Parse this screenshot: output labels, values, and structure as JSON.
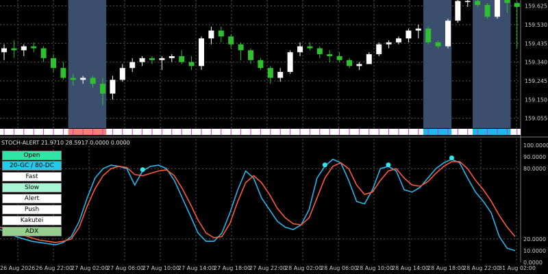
{
  "indicator": {
    "title": "STOCH-ALERT 21.9710 28.5917 0.0000 0.0000"
  },
  "buttons": {
    "open": "Open",
    "gcdc": "20-GC / 80-DC",
    "fast": "Fast",
    "slow": "Slow",
    "alert": "Alert",
    "push": "Push",
    "kakutei": "Kakutei",
    "adx": "ADX"
  },
  "price_axis": [
    "159.625",
    "159.530",
    "159.435",
    "159.340",
    "159.245",
    "159.150",
    "159.055"
  ],
  "stoch_axis": [
    "100.0000",
    "90.0000",
    "80.0000",
    "20.0000",
    "10.0000",
    "0.0000"
  ],
  "time_axis": [
    "26 Aug 2026",
    "26 Aug 22:00",
    "27 Aug 02:00",
    "27 Aug 06:00",
    "27 Aug 10:00",
    "27 Aug 14:00",
    "27 Aug 18:00",
    "27 Aug 22:00",
    "28 Aug 02:00",
    "28 Aug 06:00",
    "28 Aug 10:00",
    "28 Aug 14:00",
    "28 Aug 18:00",
    "28 Aug 22:00",
    "31 Aug 02:00"
  ],
  "colors": {
    "bull": "#ffffff",
    "bear": "#2fbf2f",
    "highlight": "#3c4e6e",
    "fast_line": "#26b7ec",
    "slow_line": "#ff5a3c",
    "marker": "#2fe6f0",
    "magenta_tick": "#cc33cc"
  },
  "chart_data": {
    "type": "candlestick",
    "price_ylim": [
      159.005,
      159.655
    ],
    "candles": [
      [
        159.39,
        159.43,
        159.35,
        159.41
      ],
      [
        159.41,
        159.45,
        159.36,
        159.4
      ],
      [
        159.4,
        159.43,
        159.37,
        159.42
      ],
      [
        159.42,
        159.44,
        159.39,
        159.41
      ],
      [
        159.41,
        159.42,
        159.34,
        159.36
      ],
      [
        159.36,
        159.38,
        159.29,
        159.31
      ],
      [
        159.31,
        159.34,
        159.25,
        159.26
      ],
      [
        159.26,
        159.28,
        159.22,
        159.25
      ],
      [
        159.25,
        159.27,
        159.23,
        159.26
      ],
      [
        159.26,
        159.27,
        159.21,
        159.23
      ],
      [
        159.23,
        159.26,
        159.12,
        159.18
      ],
      [
        159.18,
        159.27,
        159.15,
        159.25
      ],
      [
        159.25,
        159.33,
        159.24,
        159.31
      ],
      [
        159.31,
        159.36,
        159.29,
        159.34
      ],
      [
        159.34,
        159.37,
        159.32,
        159.36
      ],
      [
        159.36,
        159.37,
        159.33,
        159.35
      ],
      [
        159.35,
        159.37,
        159.3,
        159.36
      ],
      [
        159.36,
        159.38,
        159.34,
        159.37
      ],
      [
        159.37,
        159.4,
        159.33,
        159.34
      ],
      [
        159.34,
        159.37,
        159.3,
        159.32
      ],
      [
        159.32,
        159.47,
        159.3,
        159.46
      ],
      [
        159.46,
        159.52,
        159.43,
        159.5
      ],
      [
        159.5,
        159.52,
        159.44,
        159.47
      ],
      [
        159.47,
        159.48,
        159.41,
        159.43
      ],
      [
        159.43,
        159.44,
        159.35,
        159.4
      ],
      [
        159.4,
        159.41,
        159.33,
        159.35
      ],
      [
        159.35,
        159.36,
        159.3,
        159.31
      ],
      [
        159.31,
        159.32,
        159.23,
        159.26
      ],
      [
        159.26,
        159.31,
        159.24,
        159.29
      ],
      [
        159.29,
        159.4,
        159.28,
        159.39
      ],
      [
        159.39,
        159.44,
        159.37,
        159.42
      ],
      [
        159.42,
        159.44,
        159.4,
        159.41
      ],
      [
        159.41,
        159.42,
        159.36,
        159.38
      ],
      [
        159.38,
        159.4,
        159.34,
        159.37
      ],
      [
        159.37,
        159.39,
        159.34,
        159.35
      ],
      [
        159.35,
        159.36,
        159.31,
        159.32
      ],
      [
        159.32,
        159.34,
        159.3,
        159.33
      ],
      [
        159.33,
        159.39,
        159.33,
        159.38
      ],
      [
        159.38,
        159.44,
        159.37,
        159.43
      ],
      [
        159.43,
        159.45,
        159.41,
        159.44
      ],
      [
        159.44,
        159.47,
        159.43,
        159.46
      ],
      [
        159.46,
        159.51,
        159.44,
        159.5
      ],
      [
        159.5,
        159.53,
        159.46,
        159.51
      ],
      [
        159.51,
        159.52,
        159.43,
        159.44
      ],
      [
        159.44,
        159.45,
        159.41,
        159.42
      ],
      [
        159.42,
        159.56,
        159.41,
        159.55
      ],
      [
        159.55,
        159.66,
        159.54,
        159.65
      ],
      [
        159.65,
        159.67,
        159.62,
        159.65
      ],
      [
        159.65,
        159.66,
        159.62,
        159.63
      ],
      [
        159.63,
        159.64,
        159.56,
        159.57
      ],
      [
        159.57,
        159.66,
        159.56,
        159.66
      ],
      [
        159.66,
        159.67,
        159.59,
        159.64
      ],
      [
        159.64,
        159.65,
        159.41,
        159.62
      ]
    ],
    "highlight_candle_ranges": [
      [
        7,
        10
      ],
      [
        43,
        45
      ],
      [
        48,
        51
      ],
      [
        59,
        60
      ]
    ],
    "stoch_ylim": [
      0,
      100
    ],
    "series": [
      {
        "name": "Fast",
        "values": [
          28,
          25,
          22,
          20,
          18,
          17,
          16,
          15,
          17,
          22,
          35,
          55,
          72,
          80,
          83,
          82,
          80,
          66,
          78,
          82,
          83,
          80,
          70,
          55,
          40,
          25,
          18,
          18,
          25,
          42,
          62,
          78,
          72,
          55,
          45,
          35,
          30,
          28,
          32,
          45,
          72,
          82,
          88,
          85,
          70,
          52,
          50,
          62,
          80,
          82,
          78,
          62,
          60,
          64,
          72,
          80,
          85,
          88,
          85,
          72,
          60,
          52,
          42,
          22,
          12,
          10
        ]
      },
      {
        "name": "Slow",
        "values": [
          30,
          28,
          25,
          23,
          21,
          19,
          18,
          17,
          18,
          20,
          30,
          48,
          63,
          74,
          80,
          82,
          81,
          75,
          74,
          76,
          78,
          79,
          74,
          63,
          50,
          36,
          25,
          21,
          22,
          33,
          52,
          68,
          74,
          68,
          58,
          46,
          38,
          33,
          32,
          38,
          55,
          72,
          82,
          85,
          80,
          66,
          58,
          60,
          70,
          78,
          80,
          72,
          66,
          65,
          69,
          76,
          82,
          86,
          86,
          80,
          70,
          62,
          52,
          40,
          30,
          22
        ]
      }
    ],
    "alert_markers_at": [
      18,
      41,
      49,
      57
    ]
  }
}
